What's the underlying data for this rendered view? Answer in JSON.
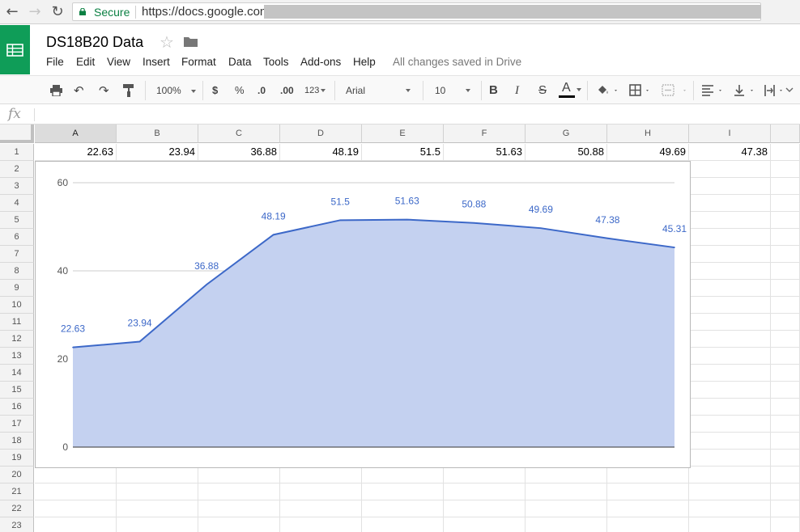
{
  "browser": {
    "secure_label": "Secure",
    "url": "https://docs.google.com"
  },
  "header": {
    "title": "DS18B20 Data",
    "menu": [
      "File",
      "Edit",
      "View",
      "Insert",
      "Format",
      "Data",
      "Tools",
      "Add-ons",
      "Help"
    ],
    "save_status": "All changes saved in Drive"
  },
  "toolbar": {
    "zoom": "100%",
    "currency": "$",
    "percent": "%",
    "decimal_decrease": ".0",
    "decimal_increase": ".00",
    "more_formats": "123",
    "font": "Arial",
    "font_size": "10",
    "bold": "B",
    "italic": "I",
    "strikethrough": "S",
    "text_color": "A"
  },
  "formula_bar": {
    "fx": "fx"
  },
  "grid": {
    "columns": [
      "A",
      "B",
      "C",
      "D",
      "E",
      "F",
      "G",
      "H",
      "I"
    ],
    "rows": [
      "1",
      "2",
      "3",
      "4",
      "5",
      "6",
      "7",
      "8",
      "9",
      "10",
      "11",
      "12",
      "13",
      "14",
      "15",
      "16",
      "17",
      "18",
      "19",
      "20",
      "21",
      "22",
      "23"
    ],
    "row1": [
      "22.63",
      "23.94",
      "36.88",
      "48.19",
      "51.5",
      "51.63",
      "50.88",
      "49.69",
      "47.38"
    ]
  },
  "colors": {
    "accent": "#0f9d58",
    "series_line": "#3c68c8",
    "series_fill": "#c4d1f0",
    "label": "#3c68c8"
  },
  "chart_data": {
    "type": "area",
    "x": [
      1,
      2,
      3,
      4,
      5,
      6,
      7,
      8,
      9,
      10
    ],
    "values": [
      22.63,
      23.94,
      36.88,
      48.19,
      51.5,
      51.63,
      50.88,
      49.69,
      47.38,
      45.31
    ],
    "data_labels": [
      "22.63",
      "23.94",
      "36.88",
      "48.19",
      "51.5",
      "51.63",
      "50.88",
      "49.69",
      "47.38",
      "45.31"
    ],
    "yticks": [
      "0",
      "20",
      "40",
      "60"
    ],
    "ylim": [
      0,
      60
    ],
    "grid": true,
    "legend": "none"
  }
}
